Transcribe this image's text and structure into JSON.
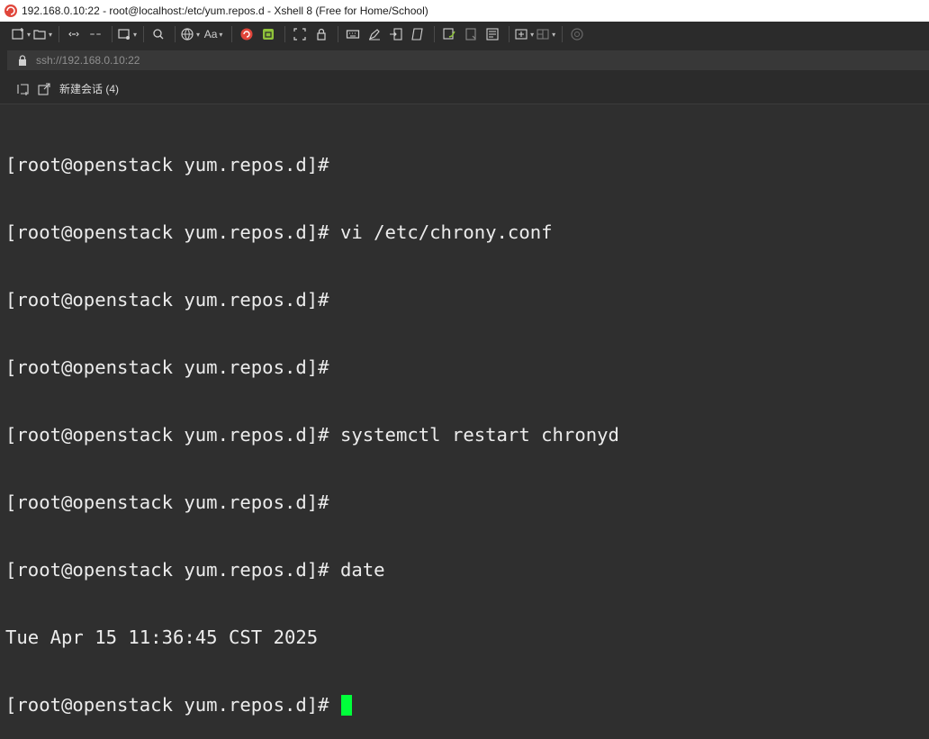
{
  "window": {
    "title": "192.168.0.10:22 - root@localhost:/etc/yum.repos.d - Xshell 8 (Free for Home/School)"
  },
  "toolbar": {
    "font_label": "Aa",
    "icons": [
      "new-session-icon",
      "open-folder-icon",
      "reconnect-icon",
      "disconnect-icon",
      "new-tab-icon",
      "find-icon",
      "globe-icon",
      "font-icon",
      "xshell-logo-icon",
      "xftp-icon",
      "fullscreen-icon",
      "lock-icon",
      "keyboard-icon",
      "script-icon",
      "transfer-icon",
      "compose-icon",
      "log-icon",
      "tile-icon",
      "layout-icon",
      "new-group-icon",
      "split-icon",
      "help-icon"
    ]
  },
  "address": {
    "value": "ssh://192.168.0.10:22"
  },
  "tabs": {
    "session_label": "新建会话 (4)"
  },
  "terminal": {
    "lines": [
      "[root@openstack yum.repos.d]#",
      "[root@openstack yum.repos.d]# vi /etc/chrony.conf",
      "[root@openstack yum.repos.d]#",
      "[root@openstack yum.repos.d]#",
      "[root@openstack yum.repos.d]# systemctl restart chronyd",
      "[root@openstack yum.repos.d]#",
      "[root@openstack yum.repos.d]# date",
      "Tue Apr 15 11:36:45 CST 2025",
      "[root@openstack yum.repos.d]# "
    ],
    "cursor_color": "#00ff3a"
  },
  "colors": {
    "accent_red": "#e0463b",
    "accent_green": "#8fc33a",
    "terminal_bg": "#2f2f2f",
    "terminal_fg": "#ececec"
  }
}
